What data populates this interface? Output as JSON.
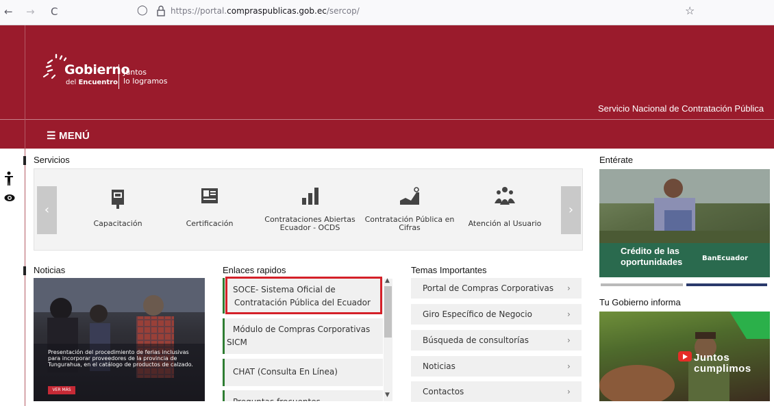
{
  "browser": {
    "url_prefix": "https://portal.",
    "url_domain": "compraspublicas.gob.ec",
    "url_path": "/sercop/",
    "back_icon": "←",
    "forward_icon": "→",
    "reload_icon": "C",
    "shield_icon": "◯",
    "star_icon": "☆"
  },
  "header": {
    "logo_title": "Gobierno",
    "logo_sub_prefix": "del ",
    "logo_sub_bold": "Encuentro",
    "slogan_line1": "Juntos",
    "slogan_line2": "lo logramos",
    "agency": "Servicio Nacional de Contratación Pública",
    "menu_label": "☰ MENÚ",
    "brand_color": "#9a1b2c"
  },
  "accessibility": {
    "person_icon": "♿",
    "eye_icon": "◉"
  },
  "servicios": {
    "title": "Servicios",
    "prev_icon": "‹",
    "next_icon": "›",
    "items": [
      {
        "label": "Capacitación",
        "icon": "presentation-icon"
      },
      {
        "label": "Certificación",
        "icon": "certificate-icon"
      },
      {
        "label_line1": "Contrataciones Abiertas",
        "label_line2": "Ecuador - OCDS",
        "icon": "bar-chart-icon"
      },
      {
        "label_line1": "Contratación Pública en",
        "label_line2": "Cifras",
        "icon": "area-chart-icon"
      },
      {
        "label": "Atención al Usuario",
        "icon": "users-icon"
      }
    ]
  },
  "noticias": {
    "title": "Noticias",
    "caption": "Presentación del procedimiento de ferias inclusivas para incorporar proveedores de la provincia de Tungurahua, en el catálogo de productos de calzado.",
    "button": "VER MÁS"
  },
  "enlaces": {
    "title": "Enlaces rapidos",
    "items": [
      {
        "line1": "SOCE- Sistema Oficial de",
        "line2": "Contratación Pública del Ecuador"
      },
      {
        "line1": "Módulo de Compras Corporativas",
        "line2": "SICM"
      },
      {
        "line1": "CHAT (Consulta En Línea)"
      },
      {
        "line1": "Preguntas frecuentes"
      }
    ],
    "scroll_up": "▲",
    "scroll_down": "▼"
  },
  "temas": {
    "title": "Temas Importantes",
    "chevron": "›",
    "items": [
      "Portal de Compras Corporativas",
      "Giro Específico de Negocio",
      "Búsqueda de consultorías",
      "Noticias",
      "Contactos"
    ]
  },
  "enterate": {
    "title": "Entérate",
    "promo_line1": "Crédito de las",
    "promo_line2": "oportunidades",
    "promo_brand": "BanEcuador"
  },
  "gobierno_informa": {
    "title": "Tu Gobierno informa",
    "video_line1": "Juntos",
    "video_line2": "cumplimos"
  }
}
